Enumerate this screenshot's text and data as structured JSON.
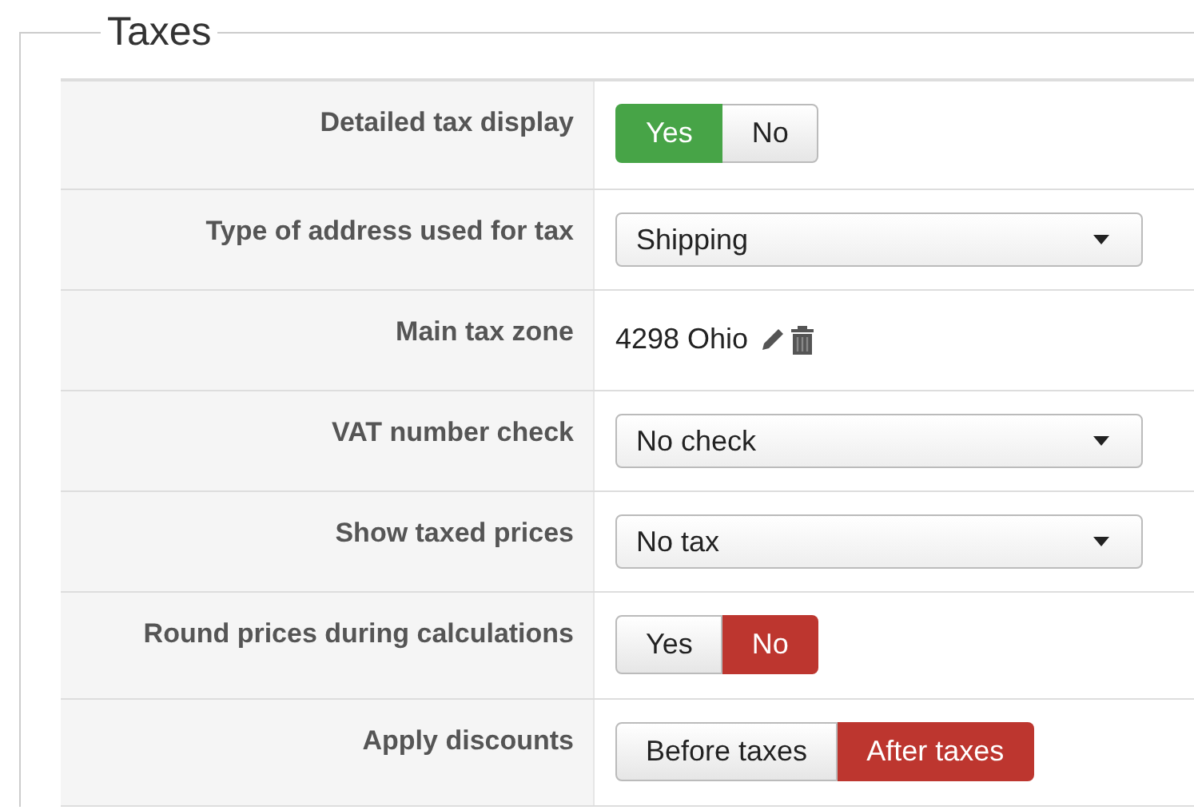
{
  "legend": "Taxes",
  "rows": [
    {
      "kind": "toggle",
      "label": "Detailed tax display",
      "options": [
        {
          "label": "Yes",
          "selected": true
        },
        {
          "label": "No",
          "selected": false
        }
      ]
    },
    {
      "kind": "select",
      "label": "Type of address used for tax",
      "value": "Shipping"
    },
    {
      "kind": "zone",
      "label": "Main tax zone",
      "value": "4298 Ohio"
    },
    {
      "kind": "select",
      "label": "VAT number check",
      "value": "No check"
    },
    {
      "kind": "select",
      "label": "Show taxed prices",
      "value": "No tax"
    },
    {
      "kind": "toggle",
      "label": "Round prices during calculations",
      "options": [
        {
          "label": "Yes",
          "selected": false
        },
        {
          "label": "No",
          "selected": true
        }
      ]
    },
    {
      "kind": "toggle",
      "label": "Apply discounts",
      "options": [
        {
          "label": "Before taxes",
          "selected": false
        },
        {
          "label": "After taxes",
          "selected": true
        }
      ]
    }
  ]
}
